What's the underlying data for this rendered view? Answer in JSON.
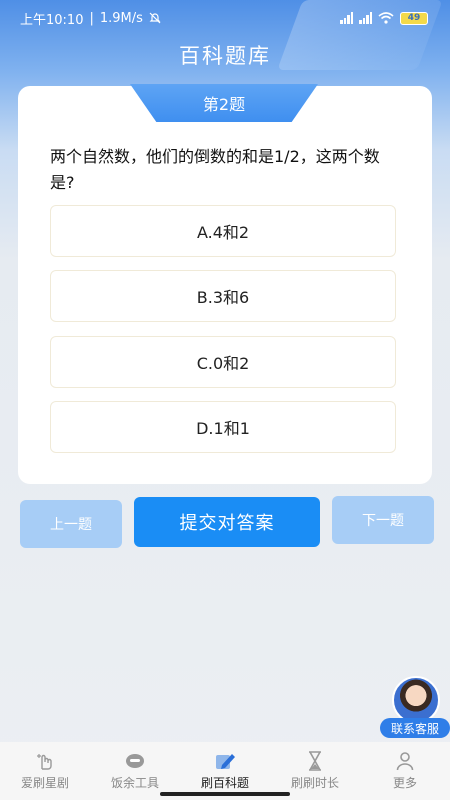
{
  "status": {
    "time": "上午10:10",
    "speed": "1.9M/s",
    "battery": "49"
  },
  "header": {
    "title": "百科题库"
  },
  "quiz": {
    "number_label": "第2题",
    "question": "两个自然数，他们的倒数的和是1/2，这两个数是?",
    "options": [
      {
        "label": "A.4和2"
      },
      {
        "label": "B.3和6"
      },
      {
        "label": "C.0和2"
      },
      {
        "label": "D.1和1"
      }
    ]
  },
  "actions": {
    "prev_label": "上一题",
    "submit_label": "提交对答案",
    "next_label": "下一题"
  },
  "service": {
    "label": "联系客服"
  },
  "tabbar": {
    "items": [
      {
        "label": "爱刷星剧",
        "icon": "hand-icon"
      },
      {
        "label": "饭余工具",
        "icon": "toolbox-icon"
      },
      {
        "label": "刷百科题",
        "icon": "pencil-icon",
        "active": true
      },
      {
        "label": "刷刷时长",
        "icon": "hourglass-icon"
      },
      {
        "label": "更多",
        "icon": "user-icon"
      }
    ]
  },
  "colors": {
    "accent": "#1a8df5",
    "secondary_button": "#a7cdf6",
    "header_blue": "#4f8fe6"
  }
}
